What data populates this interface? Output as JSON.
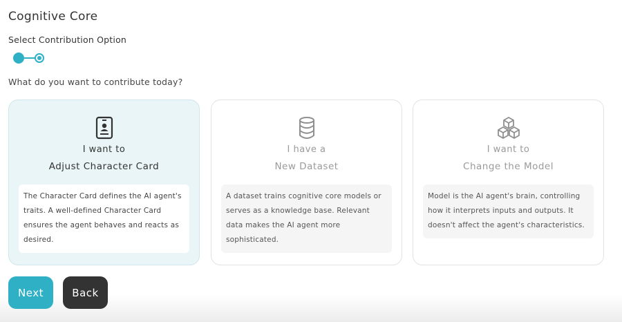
{
  "page": {
    "title": "Cognitive Core",
    "subtitle": "Select Contribution Option",
    "question": "What do you want to contribute today?"
  },
  "stepper": {
    "total_steps": 2,
    "current_step": 2
  },
  "options": [
    {
      "line1": "I want to",
      "line2": "Adjust Character Card",
      "description": "The Character Card defines the AI agent's traits. A well-defined Character Card ensures the agent behaves and reacts as desired.",
      "icon": "id-card-icon",
      "selected": true
    },
    {
      "line1": "I have a",
      "line2": "New Dataset",
      "description": "A dataset trains cognitive core models or serves as a knowledge base. Relevant data makes the AI agent more sophisticated.",
      "icon": "database-icon",
      "selected": false
    },
    {
      "line1": "I want to",
      "line2": "Change the Model",
      "description": "Model is the AI agent's brain, controlling how it interprets inputs and outputs. It doesn't affect the agent's characteristics.",
      "icon": "cubes-icon",
      "selected": false
    }
  ],
  "buttons": {
    "next": "Next",
    "back": "Back"
  },
  "colors": {
    "accent": "#2fb0c4",
    "dark_button": "#333333",
    "selected_card_bg": "#eaf5f7"
  }
}
